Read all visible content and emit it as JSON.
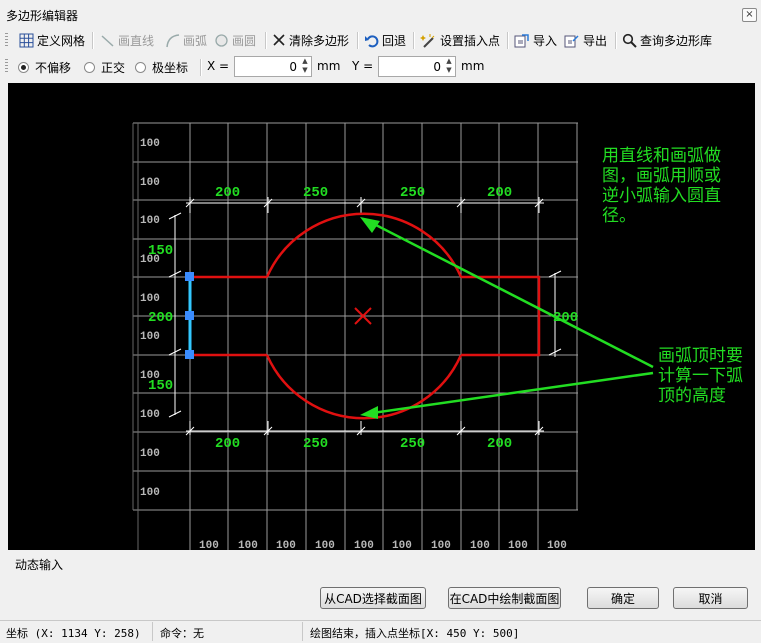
{
  "window": {
    "title": "多边形编辑器",
    "close": "×"
  },
  "toolbar": {
    "define_grid": "定义网格",
    "line": "画直线",
    "arc": "画弧",
    "circle": "画圆",
    "clear_polygon": "清除多边形",
    "undo": "回退",
    "set_insert_point": "设置插入点",
    "import": "导入",
    "export": "导出",
    "query_library": "查询多边形库"
  },
  "options": {
    "no_offset": "不偏移",
    "ortho": "正交",
    "polar": "极坐标",
    "x_label": "X =",
    "x_value": "0",
    "x_unit": "mm",
    "y_label": "Y =",
    "y_value": "0",
    "y_unit": "mm"
  },
  "canvas": {
    "row_labels": [
      "100",
      "100",
      "100",
      "100",
      "100",
      "100",
      "100",
      "100",
      "100",
      "100"
    ],
    "col_labels": [
      "100",
      "100",
      "100",
      "100",
      "100",
      "100",
      "100",
      "100",
      "100",
      "100"
    ],
    "top_dims": [
      "200",
      "250",
      "250",
      "200"
    ],
    "bottom_dims": [
      "200",
      "250",
      "250",
      "200"
    ],
    "left_dims": [
      "150",
      "200",
      "150"
    ],
    "right_dim": "200",
    "note1": [
      "用直线和画弧做",
      "图，画弧用顺或",
      "逆小弧输入圆直",
      "径。"
    ],
    "note2": [
      "画弧顶时要",
      "计算一下弧",
      "顶的高度"
    ],
    "colors": {
      "outline": "#e01010",
      "grid": "#9a9a9a",
      "annotation": "#22dd22",
      "dims": "#ffffff",
      "selected": "#33c8ff"
    }
  },
  "dynamic_input": "动态输入",
  "buttons": {
    "select_from_cad": "从CAD选择截面图",
    "draw_in_cad": "在CAD中绘制截面图",
    "ok": "确定",
    "cancel": "取消"
  },
  "status": {
    "coords": "坐标 (X: 1134 Y: 258)",
    "command": "命令：无",
    "message": "绘图结束，插入点坐标[X: 450 Y: 500]"
  }
}
